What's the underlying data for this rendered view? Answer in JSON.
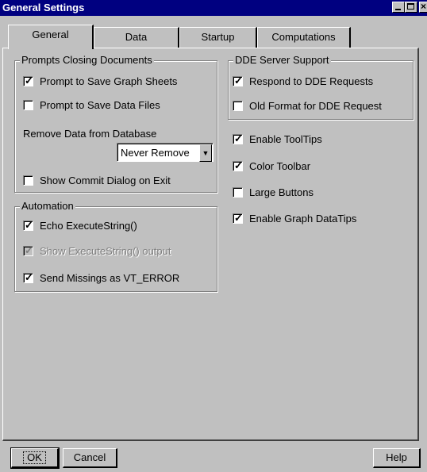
{
  "window": {
    "title": "General Settings"
  },
  "tabs": [
    {
      "label": "General",
      "active": true
    },
    {
      "label": "Data",
      "active": false
    },
    {
      "label": "Startup",
      "active": false
    },
    {
      "label": "Computations",
      "active": false
    }
  ],
  "prompts_group": {
    "title": "Prompts Closing Documents",
    "save_graph_label": "Prompt to Save Graph Sheets",
    "save_graph_checked": true,
    "save_data_label": "Prompt to Save Data Files",
    "save_data_checked": false,
    "remove_label": "Remove Data from Database",
    "remove_value": "Never Remove",
    "commit_label": "Show Commit Dialog on Exit",
    "commit_checked": false
  },
  "automation_group": {
    "title": "Automation",
    "echo_label": "Echo ExecuteString()",
    "echo_checked": true,
    "show_output_label": "Show ExecuteString() output",
    "show_output_checked": true,
    "show_output_disabled": true,
    "missings_label": "Send Missings as VT_ERROR",
    "missings_checked": true
  },
  "dde_group": {
    "title": "DDE Server Support",
    "respond_label": "Respond to DDE Requests",
    "respond_checked": true,
    "old_format_label": "Old Format for DDE Request",
    "old_format_checked": false
  },
  "options": {
    "tooltips_label": "Enable ToolTips",
    "tooltips_checked": true,
    "color_toolbar_label": "Color Toolbar",
    "color_toolbar_checked": true,
    "large_buttons_label": "Large Buttons",
    "large_buttons_checked": false,
    "datatips_label": "Enable Graph DataTips",
    "datatips_checked": true
  },
  "buttons": {
    "ok": "OK",
    "cancel": "Cancel",
    "help": "Help"
  },
  "colors": {
    "titlebar": "#000080",
    "face": "#c0c0c0"
  },
  "icons": {
    "minimize": "minimize-icon",
    "maximize": "maximize-icon",
    "close": "close-icon",
    "check": "checkmark-icon",
    "dropdown": "chevron-down-icon"
  }
}
